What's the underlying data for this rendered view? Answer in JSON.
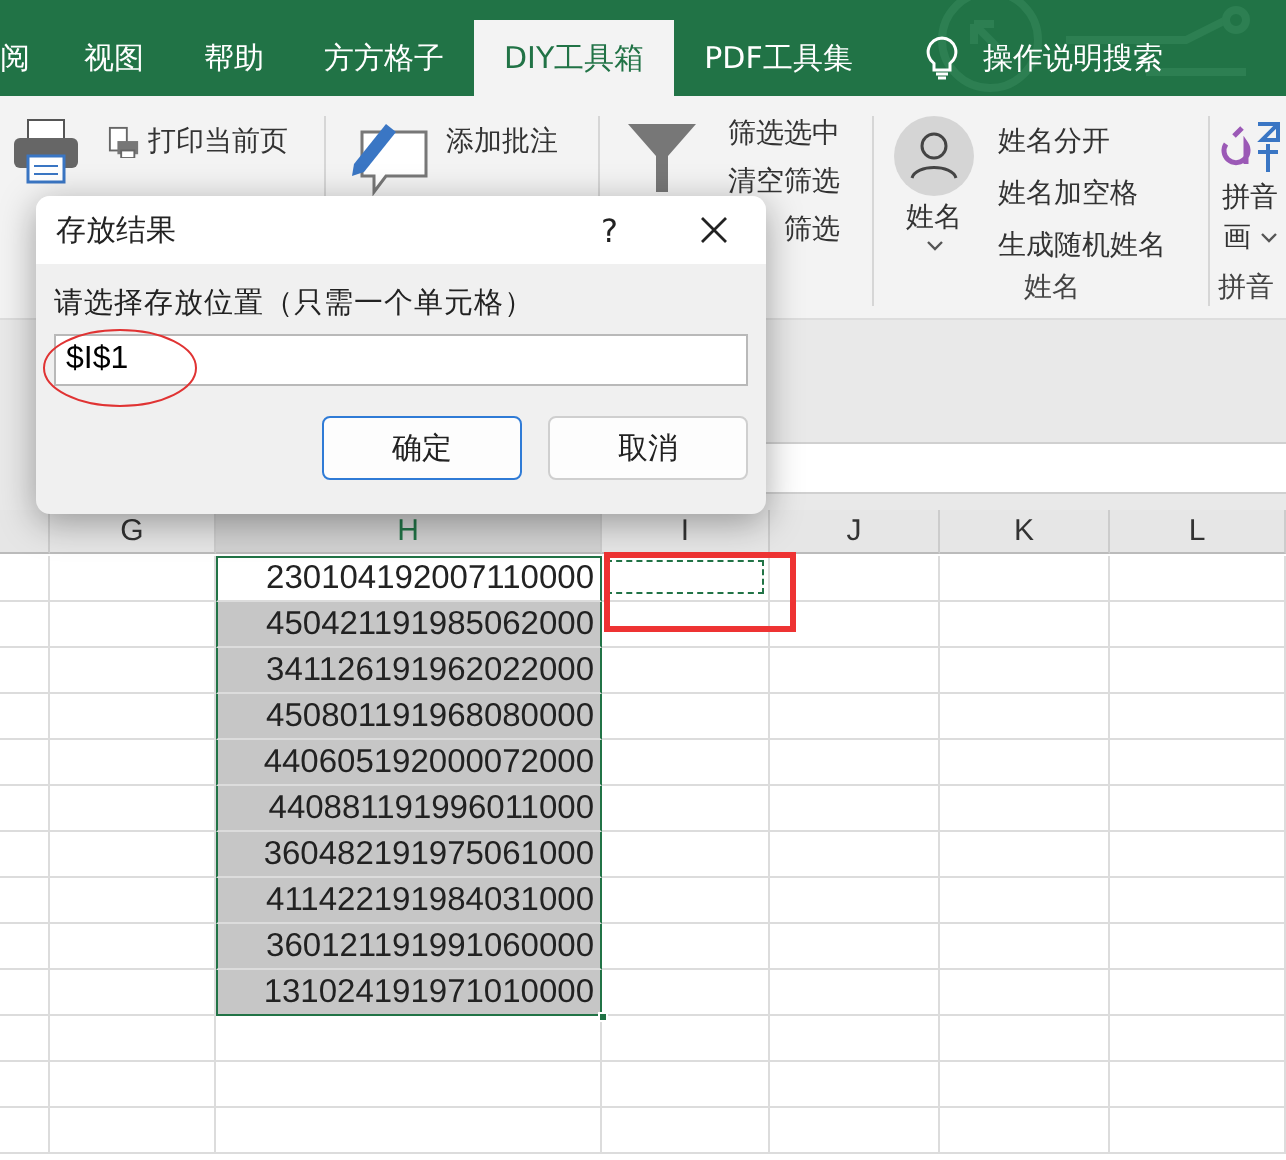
{
  "tabs": [
    {
      "label": "阅",
      "selected": false
    },
    {
      "label": "视图",
      "selected": false
    },
    {
      "label": "帮助",
      "selected": false
    },
    {
      "label": "方方格子",
      "selected": false
    },
    {
      "label": "DIY工具箱",
      "selected": true
    },
    {
      "label": "PDF工具集",
      "selected": false
    }
  ],
  "search": {
    "label": "操作说明搜索"
  },
  "ribbon": {
    "print": {
      "items": [
        "打印当前页"
      ]
    },
    "comments": {
      "items": [
        "添加批注"
      ]
    },
    "filter": {
      "items": [
        "筛选选中",
        "清空筛选",
        "筛选"
      ]
    },
    "names": {
      "big_label": "姓名",
      "items": [
        "姓名分开",
        "姓名加空格",
        "生成随机姓名"
      ],
      "group_label": "姓名"
    },
    "pinyin": {
      "big_label": "拼音",
      "big_label_2": "画",
      "group_label": "拼音"
    }
  },
  "dialog": {
    "title": "存放结果",
    "help": "?",
    "prompt": "请选择存放位置（只需一个单元格）",
    "value": "$I$1",
    "buttons": [
      {
        "label": "确定",
        "focused": true
      },
      {
        "label": "取消",
        "focused": false
      }
    ]
  },
  "sheet": {
    "columns": [
      {
        "selected": false,
        "marquee": false
      },
      {
        "label": "G",
        "selected": false,
        "marquee": false
      },
      {
        "label": "H",
        "selected": true,
        "marquee": false
      },
      {
        "label": "I",
        "selected": false,
        "marquee": true
      },
      {
        "label": "J",
        "selected": false,
        "marquee": false
      },
      {
        "label": "K",
        "selected": false,
        "marquee": false
      },
      {
        "label": "L",
        "selected": false,
        "marquee": false
      }
    ],
    "selected_values": [
      "230104192007110000",
      "450421191985062000",
      "341126191962022000",
      "450801191968080000",
      "440605192000072000",
      "440881191996011000",
      "360482191975061000",
      "411422191984031000",
      "360121191991060000",
      "131024191971010000"
    ]
  }
}
